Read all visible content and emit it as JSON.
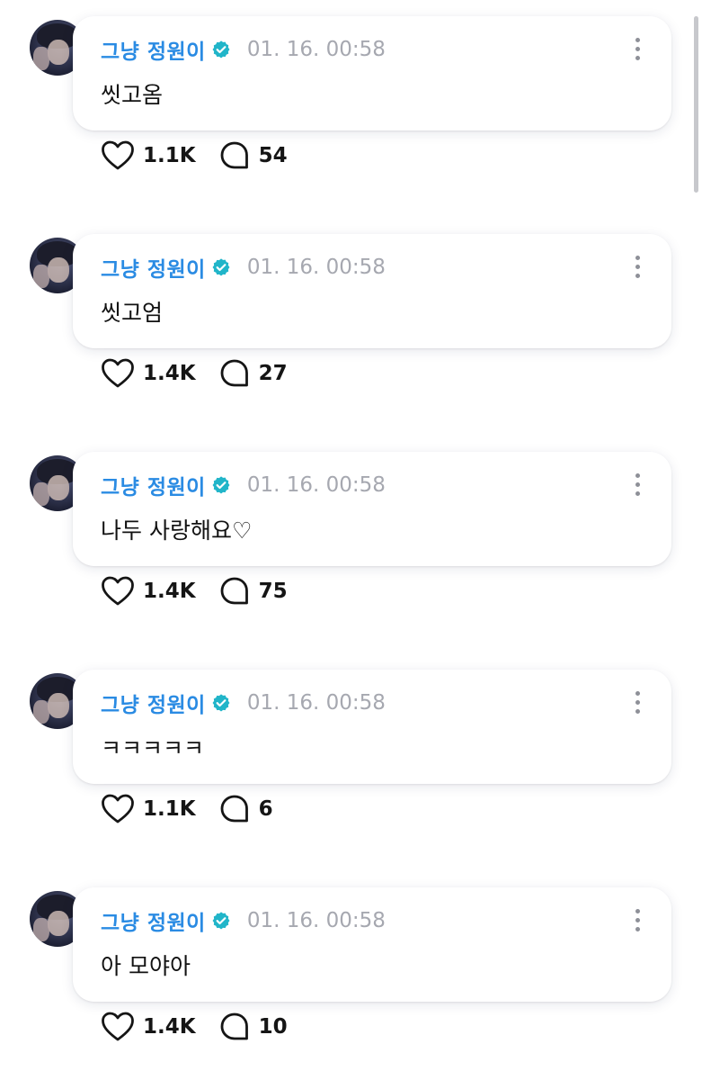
{
  "posts": [
    {
      "author": "그냥 정원이",
      "timestamp": "01. 16. 00:58",
      "text": "씻고옴",
      "likes": "1.1K",
      "replies": "54"
    },
    {
      "author": "그냥 정원이",
      "timestamp": "01. 16. 00:58",
      "text": "씻고엄",
      "likes": "1.4K",
      "replies": "27"
    },
    {
      "author": "그냥 정원이",
      "timestamp": "01. 16. 00:58",
      "text": "나두 사랑해요♡",
      "likes": "1.4K",
      "replies": "75"
    },
    {
      "author": "그냥 정원이",
      "timestamp": "01. 16. 00:58",
      "text": "ㅋㅋㅋㅋㅋ",
      "likes": "1.1K",
      "replies": "6"
    },
    {
      "author": "그냥 정원이",
      "timestamp": "01. 16. 00:58",
      "text": "아 모야아",
      "likes": "1.4K",
      "replies": "10"
    }
  ],
  "colors": {
    "username": "#2a8be3",
    "verified_badge": "#21b5c9",
    "timestamp": "#a6a8b0"
  },
  "icons": {
    "verified": "verified-badge-icon",
    "more": "more-vertical-icon",
    "like": "heart-outline-icon",
    "reply": "speech-bubble-icon"
  }
}
